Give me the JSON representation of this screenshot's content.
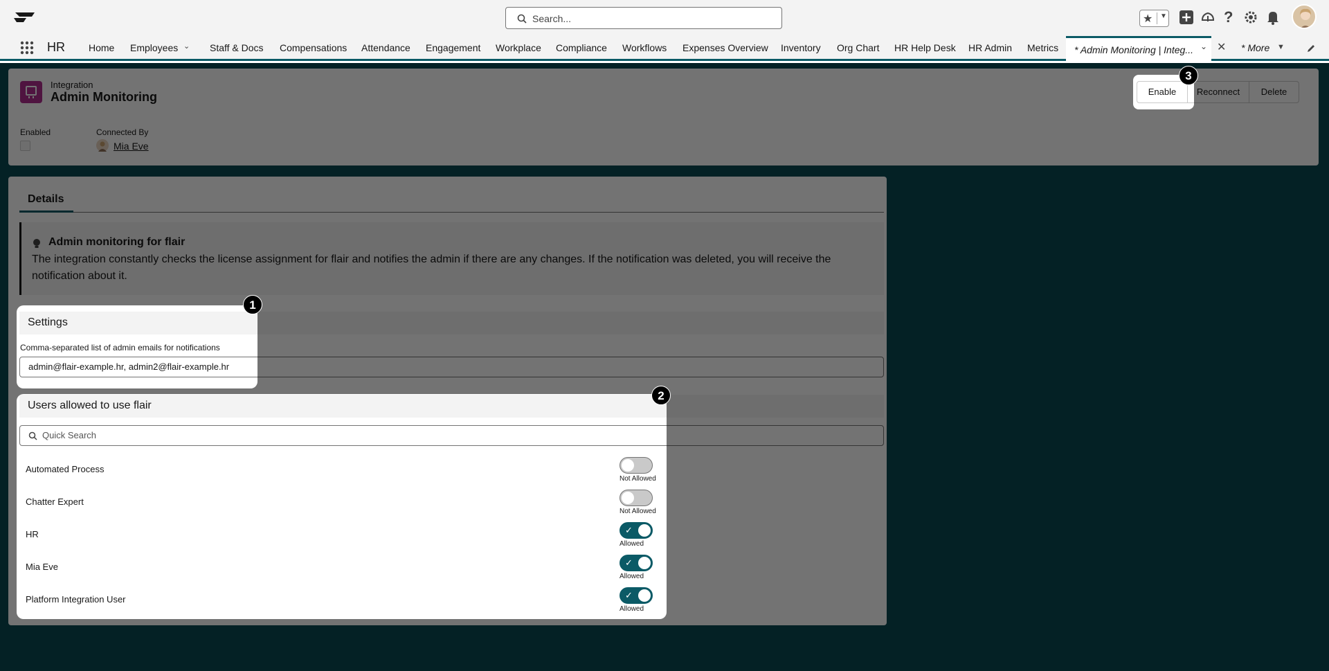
{
  "topbar": {
    "search_placeholder": "Search...",
    "icons": [
      "favorites-star-icon",
      "global-add-icon",
      "trailhead-icon",
      "help-icon",
      "setup-gear-icon",
      "notification-bell-icon"
    ]
  },
  "nav": {
    "app_name": "HR",
    "items": [
      "Home",
      "Employees",
      "Staff & Docs",
      "Compensations",
      "Attendance",
      "Engagement",
      "Workplace",
      "Compliance",
      "Workflows",
      "Expenses Overview",
      "Inventory",
      "Org Chart",
      "HR Help Desk",
      "HR Admin",
      "Metrics"
    ],
    "active_tab": "* Admin Monitoring | Integ...",
    "more": "* More"
  },
  "record": {
    "object_label": "Integration",
    "title": "Admin Monitoring",
    "buttons": {
      "enable": "Enable",
      "reconnect": "Reconnect",
      "delete": "Delete"
    },
    "enabled_label": "Enabled",
    "connected_by_label": "Connected By",
    "connected_by": "Mia Eve"
  },
  "details": {
    "tab_label": "Details",
    "info_title": "Admin monitoring for flair",
    "info_text": "The integration constantly checks the license assignment for flair and notifies the admin if there are any changes. If the notification was deleted, you will receive the notification about it.",
    "settings_heading": "Settings",
    "emails_label": "Comma-separated list of admin emails for notifications",
    "emails_value": "admin@flair-example.hr, admin2@flair-example.hr",
    "users_heading": "Users allowed to use flair",
    "quick_search_placeholder": "Quick Search",
    "users": [
      {
        "name": "Automated Process",
        "status": "Not Allowed",
        "allowed": false
      },
      {
        "name": "Chatter Expert",
        "status": "Not Allowed",
        "allowed": false
      },
      {
        "name": "HR",
        "status": "Allowed",
        "allowed": true
      },
      {
        "name": "Mia Eve",
        "status": "Allowed",
        "allowed": true
      },
      {
        "name": "Platform Integration User",
        "status": "Allowed",
        "allowed": true
      }
    ]
  },
  "callouts": [
    "1",
    "2",
    "3"
  ],
  "colors": {
    "page_bg": "#0b4a52",
    "accent": "#0b5a66",
    "icon_bg": "#b02d8e"
  }
}
